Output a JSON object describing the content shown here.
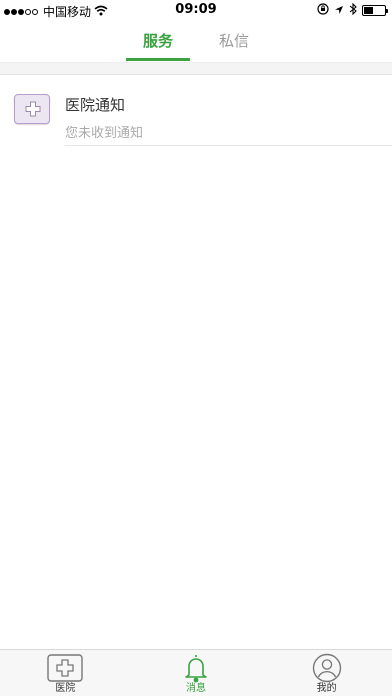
{
  "status_bar": {
    "carrier": "中国移动",
    "time": "09:09",
    "battery_level": 0.45
  },
  "top_tabs": [
    {
      "label": "服务",
      "active": true
    },
    {
      "label": "私信",
      "active": false
    }
  ],
  "list": [
    {
      "title": "医院通知",
      "subtitle": "您未收到通知",
      "icon": "hospital-cross-icon"
    }
  ],
  "bottom_tabs": [
    {
      "label": "医院",
      "icon": "hospital-cross-icon",
      "active": false
    },
    {
      "label": "消息",
      "icon": "bell-icon",
      "active": true
    },
    {
      "label": "我的",
      "icon": "user-icon",
      "active": false
    }
  ],
  "colors": {
    "accent": "#3aa23f",
    "icon_bg": "#ece6f3",
    "icon_border": "#b59cc8"
  }
}
